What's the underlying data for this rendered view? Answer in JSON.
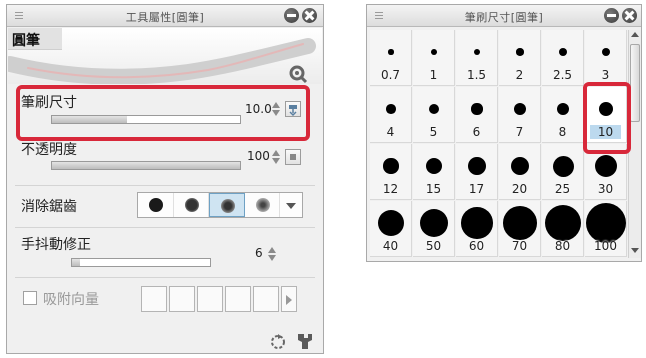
{
  "tool_panel": {
    "title": "工具屬性[圓筆]",
    "brush_name": "圓筆",
    "brush_size": {
      "label": "筆刷尺寸",
      "value": "10.0",
      "slider_level": 0.4
    },
    "opacity": {
      "label": "不透明度",
      "value": "100",
      "slider_level": 1.0
    },
    "anti_alias": {
      "label": "消除鋸齒",
      "selected_index": 2
    },
    "stabilization": {
      "label": "手抖動修正",
      "value": "6",
      "slider_level": 0.06
    },
    "snap": {
      "label": "吸附向量"
    }
  },
  "size_panel": {
    "title": "筆刷尺寸[圓筆]",
    "sizes": [
      "0.7",
      "1",
      "1.5",
      "2",
      "2.5",
      "3",
      "4",
      "5",
      "6",
      "7",
      "8",
      "10",
      "12",
      "15",
      "17",
      "20",
      "25",
      "30",
      "40",
      "50",
      "60",
      "70",
      "80",
      "100"
    ],
    "selected": "10"
  },
  "colors": {
    "highlight": "#d8283a",
    "selection": "#bcd9ee"
  }
}
